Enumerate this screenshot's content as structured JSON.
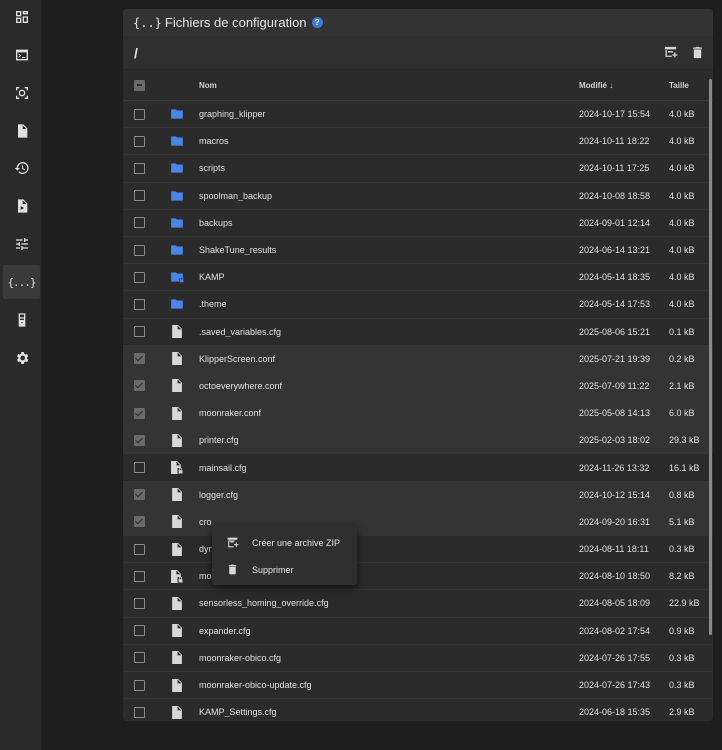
{
  "sidebar": {
    "items": [
      {
        "name": "dashboard-icon"
      },
      {
        "name": "console-icon"
      },
      {
        "name": "webcam-icon"
      },
      {
        "name": "gcode-files-icon"
      },
      {
        "name": "history-icon"
      },
      {
        "name": "timelapse-icon"
      },
      {
        "name": "tune-icon"
      },
      {
        "name": "config-braces-icon",
        "label": "{...}",
        "active": true
      },
      {
        "name": "machine-icon"
      },
      {
        "name": "settings-icon"
      }
    ]
  },
  "panel": {
    "title_braces": "{..}",
    "title": "Fichiers de configuration",
    "help": "?"
  },
  "path": {
    "current": "/"
  },
  "table": {
    "headers": {
      "name": "Nom",
      "modified": "Modifié",
      "size": "Taille"
    },
    "rows": [
      {
        "type": "folder",
        "name": "graphing_klipper",
        "modified": "2024-10-17 15:54",
        "size": "4.0 kB",
        "checked": false
      },
      {
        "type": "folder",
        "name": "macros",
        "modified": "2024-10-11 18:22",
        "size": "4.0 kB",
        "checked": false
      },
      {
        "type": "folder",
        "name": "scripts",
        "modified": "2024-10-11 17:25",
        "size": "4.0 kB",
        "checked": false
      },
      {
        "type": "folder",
        "name": "spoolman_backup",
        "modified": "2024-10-08 18:58",
        "size": "4.0 kB",
        "checked": false
      },
      {
        "type": "folder",
        "name": "backups",
        "modified": "2024-09-01 12:14",
        "size": "4.0 kB",
        "checked": false
      },
      {
        "type": "folder",
        "name": "ShakeTune_results",
        "modified": "2024-06-14 13:21",
        "size": "4.0 kB",
        "checked": false
      },
      {
        "type": "folder-lock",
        "name": "KAMP",
        "modified": "2024-05-14 18:35",
        "size": "4.0 kB",
        "checked": false
      },
      {
        "type": "folder",
        "name": ".theme",
        "modified": "2024-05-14 17:53",
        "size": "4.0 kB",
        "checked": false
      },
      {
        "type": "file",
        "name": ".saved_variables.cfg",
        "modified": "2025-08-06 15:21",
        "size": "0.1 kB",
        "checked": false
      },
      {
        "type": "file",
        "name": "KlipperScreen.conf",
        "modified": "2025-07-21 19:39",
        "size": "0.2 kB",
        "checked": true
      },
      {
        "type": "file",
        "name": "octoeverywhere.conf",
        "modified": "2025-07-09 11:22",
        "size": "2.1 kB",
        "checked": true
      },
      {
        "type": "file",
        "name": "moonraker.conf",
        "modified": "2025-05-08 14:13",
        "size": "6.0 kB",
        "checked": true
      },
      {
        "type": "file",
        "name": "printer.cfg",
        "modified": "2025-02-03 18:02",
        "size": "29.3 kB",
        "checked": true
      },
      {
        "type": "file-lock",
        "name": "mainsail.cfg",
        "modified": "2024-11-26 13:32",
        "size": "16.1 kB",
        "checked": false
      },
      {
        "type": "file",
        "name": "logger.cfg",
        "modified": "2024-10-12 15:14",
        "size": "0.8 kB",
        "checked": true
      },
      {
        "type": "file",
        "name": "cro",
        "modified": "2024-09-20 16:31",
        "size": "5.1 kB",
        "checked": true
      },
      {
        "type": "file",
        "name": "dyn",
        "modified": "2024-08-11 18:11",
        "size": "0.3 kB",
        "checked": false
      },
      {
        "type": "file-lock",
        "name": "mo",
        "modified": "2024-08-10 18:50",
        "size": "8.2 kB",
        "checked": false
      },
      {
        "type": "file",
        "name": "sensorless_homing_override.cfg",
        "modified": "2024-08-05 18:09",
        "size": "22.9 kB",
        "checked": false
      },
      {
        "type": "file",
        "name": "expander.cfg",
        "modified": "2024-08-02 17:54",
        "size": "0.9 kB",
        "checked": false
      },
      {
        "type": "file",
        "name": "moonraker-obico.cfg",
        "modified": "2024-07-26 17:55",
        "size": "0.3 kB",
        "checked": false
      },
      {
        "type": "file",
        "name": "moonraker-obico-update.cfg",
        "modified": "2024-07-26 17:43",
        "size": "0.3 kB",
        "checked": false
      },
      {
        "type": "file",
        "name": "KAMP_Settings.cfg",
        "modified": "2024-06-18 15:35",
        "size": "2.9 kB",
        "checked": false
      }
    ]
  },
  "context_menu": {
    "items": [
      {
        "name": "create-zip-item",
        "icon": "archive-plus-icon",
        "label": "Créer une archive ZIP"
      },
      {
        "name": "delete-item",
        "icon": "trash-icon",
        "label": "Supprimer"
      }
    ]
  },
  "colors": {
    "folder": "#4a86e8",
    "file": "#d8d8d8",
    "accent": "#3a7ad9"
  }
}
